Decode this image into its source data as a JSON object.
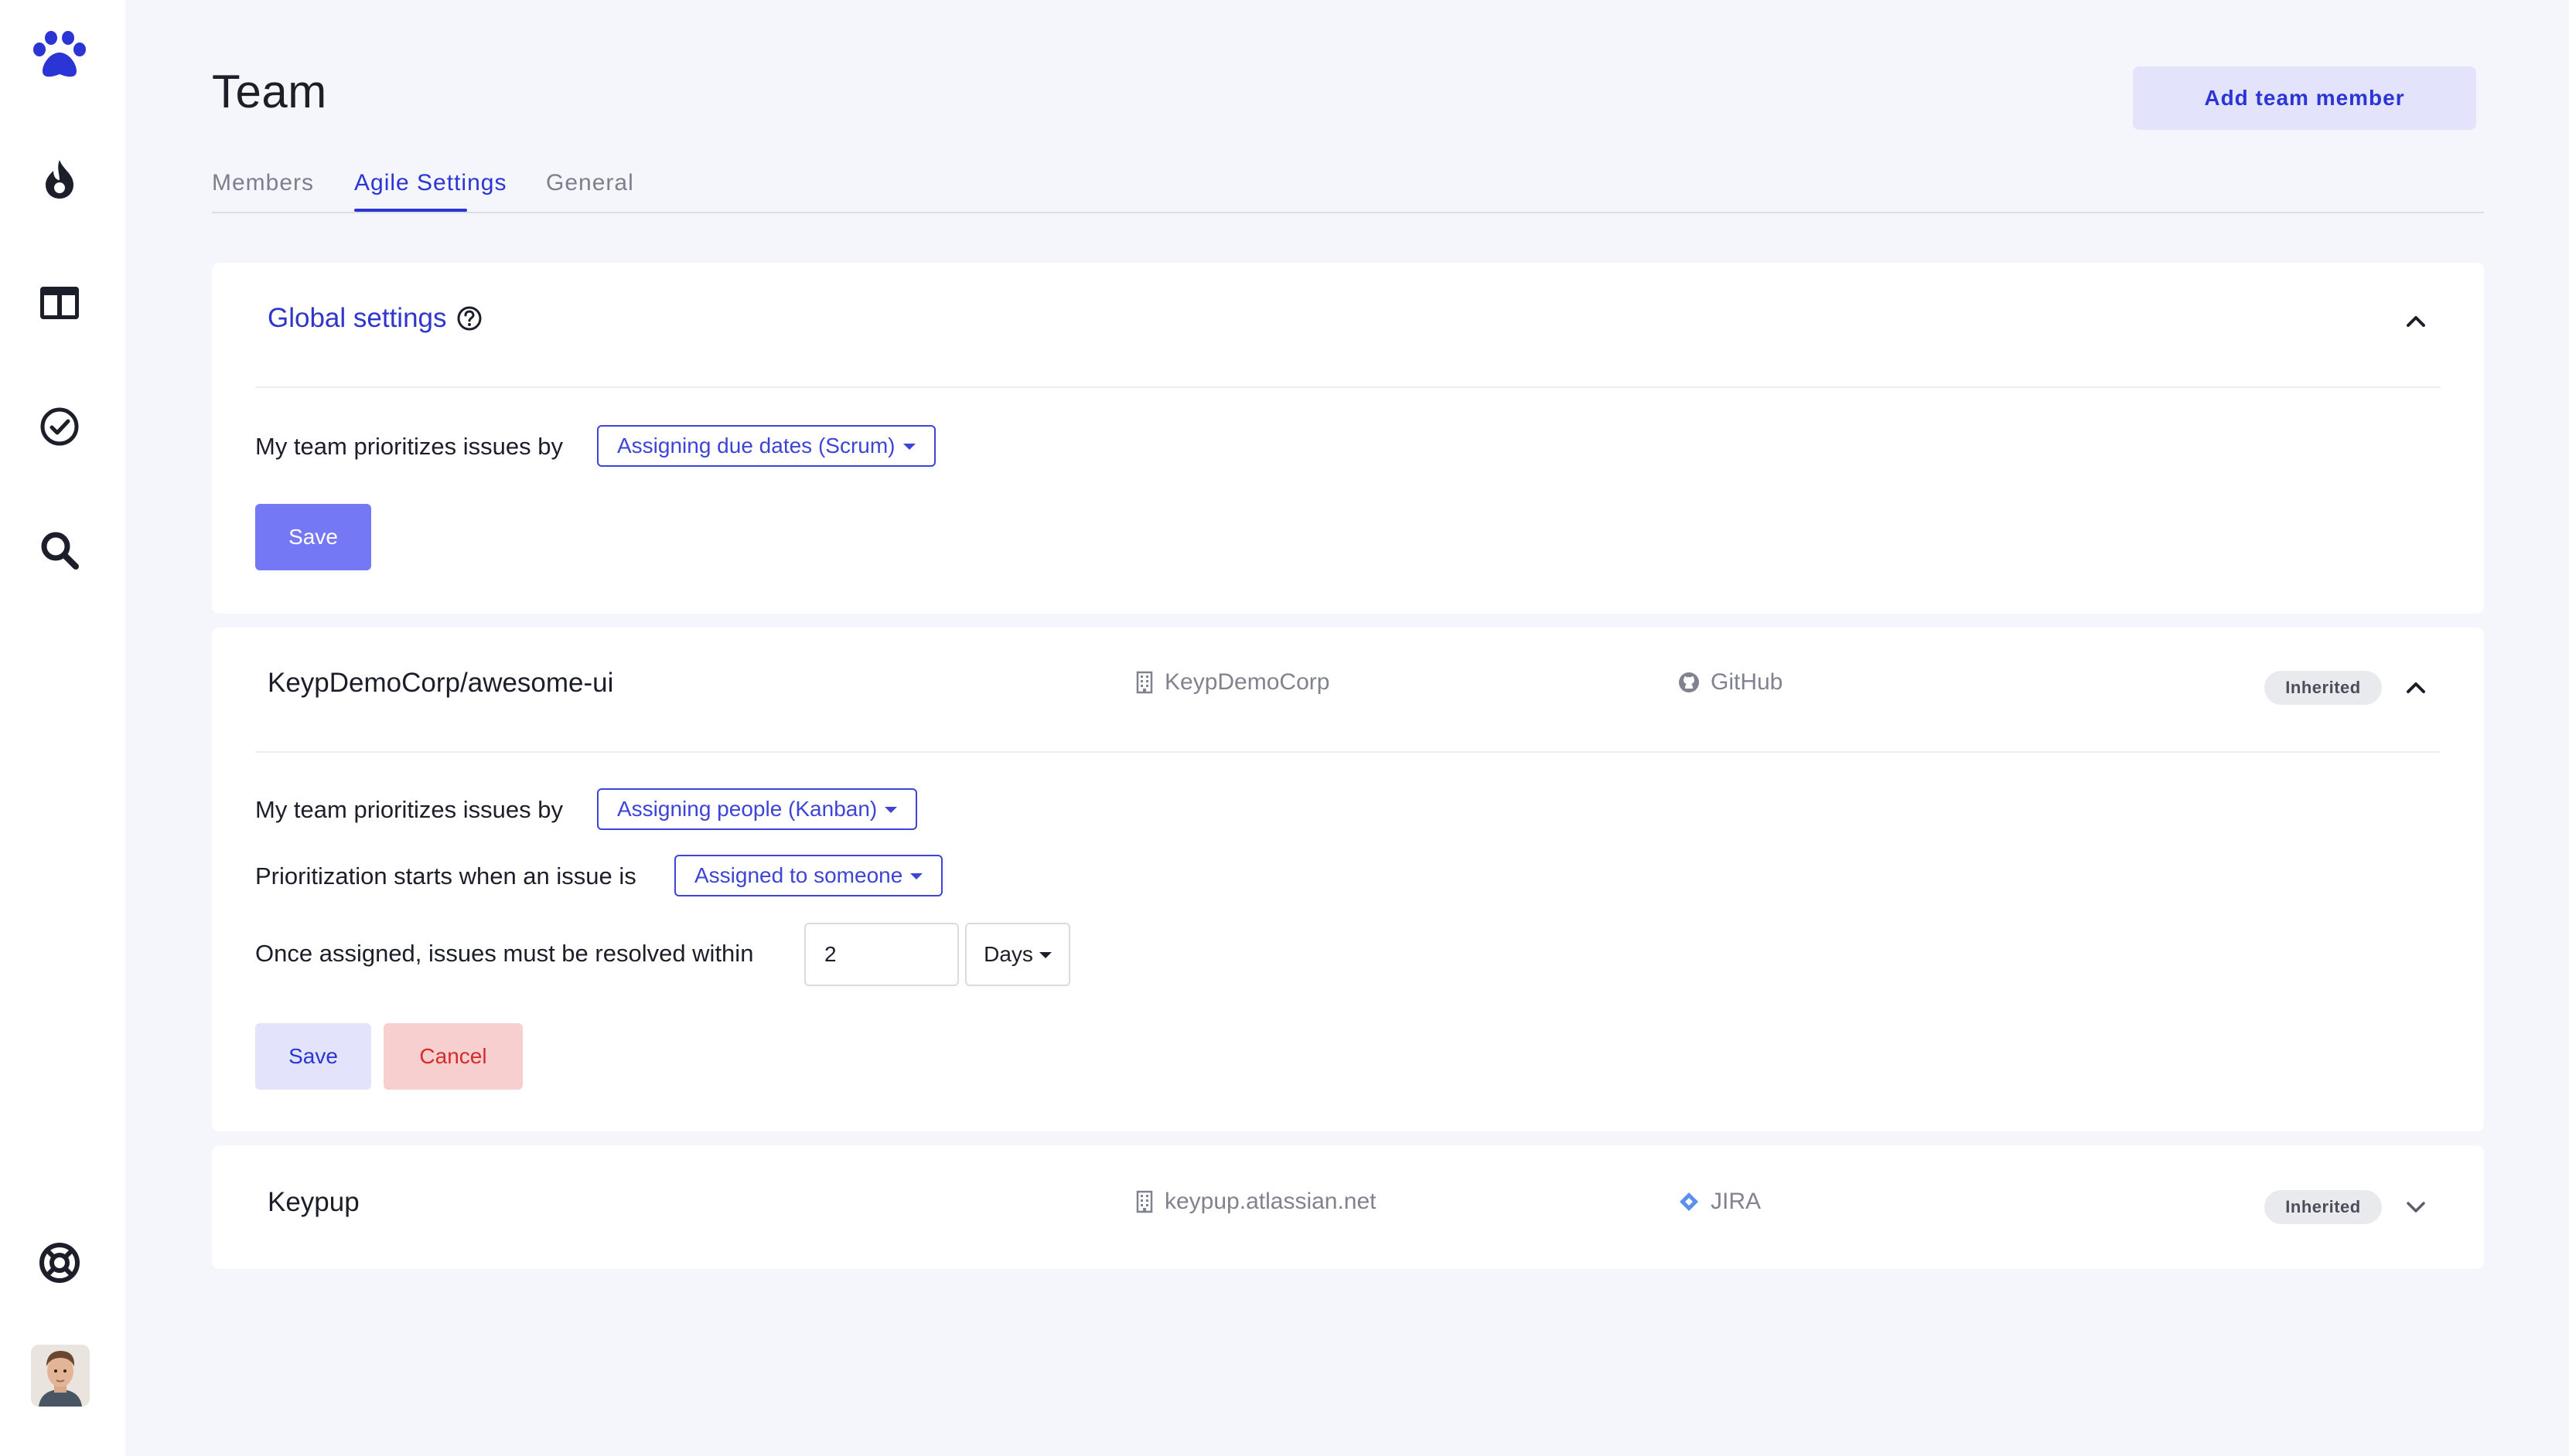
{
  "sidebar": {
    "icons": [
      "paw-logo-icon",
      "fire-icon",
      "board-icon",
      "check-circle-icon",
      "search-icon",
      "help-lifebuoy-icon"
    ],
    "brand_color": "#2b35d6"
  },
  "header": {
    "title": "Team",
    "add_button": "Add team member"
  },
  "tabs": [
    {
      "label": "Members",
      "active": false
    },
    {
      "label": "Agile Settings",
      "active": true
    },
    {
      "label": "General",
      "active": false
    }
  ],
  "global_settings": {
    "title": "Global settings",
    "prioritize_label": "My team prioritizes issues by",
    "prioritize_value": "Assigning due dates (Scrum)",
    "save_label": "Save"
  },
  "repo1": {
    "name": "KeypDemoCorp/awesome-ui",
    "org": "KeypDemoCorp",
    "provider": "GitHub",
    "badge": "Inherited",
    "prioritize_label": "My team prioritizes issues by",
    "prioritize_value": "Assigning people (Kanban)",
    "start_label": "Prioritization starts when an issue is",
    "start_value": "Assigned to someone",
    "resolve_label": "Once assigned, issues must be resolved within",
    "resolve_value": "2",
    "resolve_unit": "Days",
    "save_label": "Save",
    "cancel_label": "Cancel"
  },
  "repo2": {
    "name": "Keypup",
    "org": "keypup.atlassian.net",
    "provider": "JIRA",
    "badge": "Inherited"
  }
}
